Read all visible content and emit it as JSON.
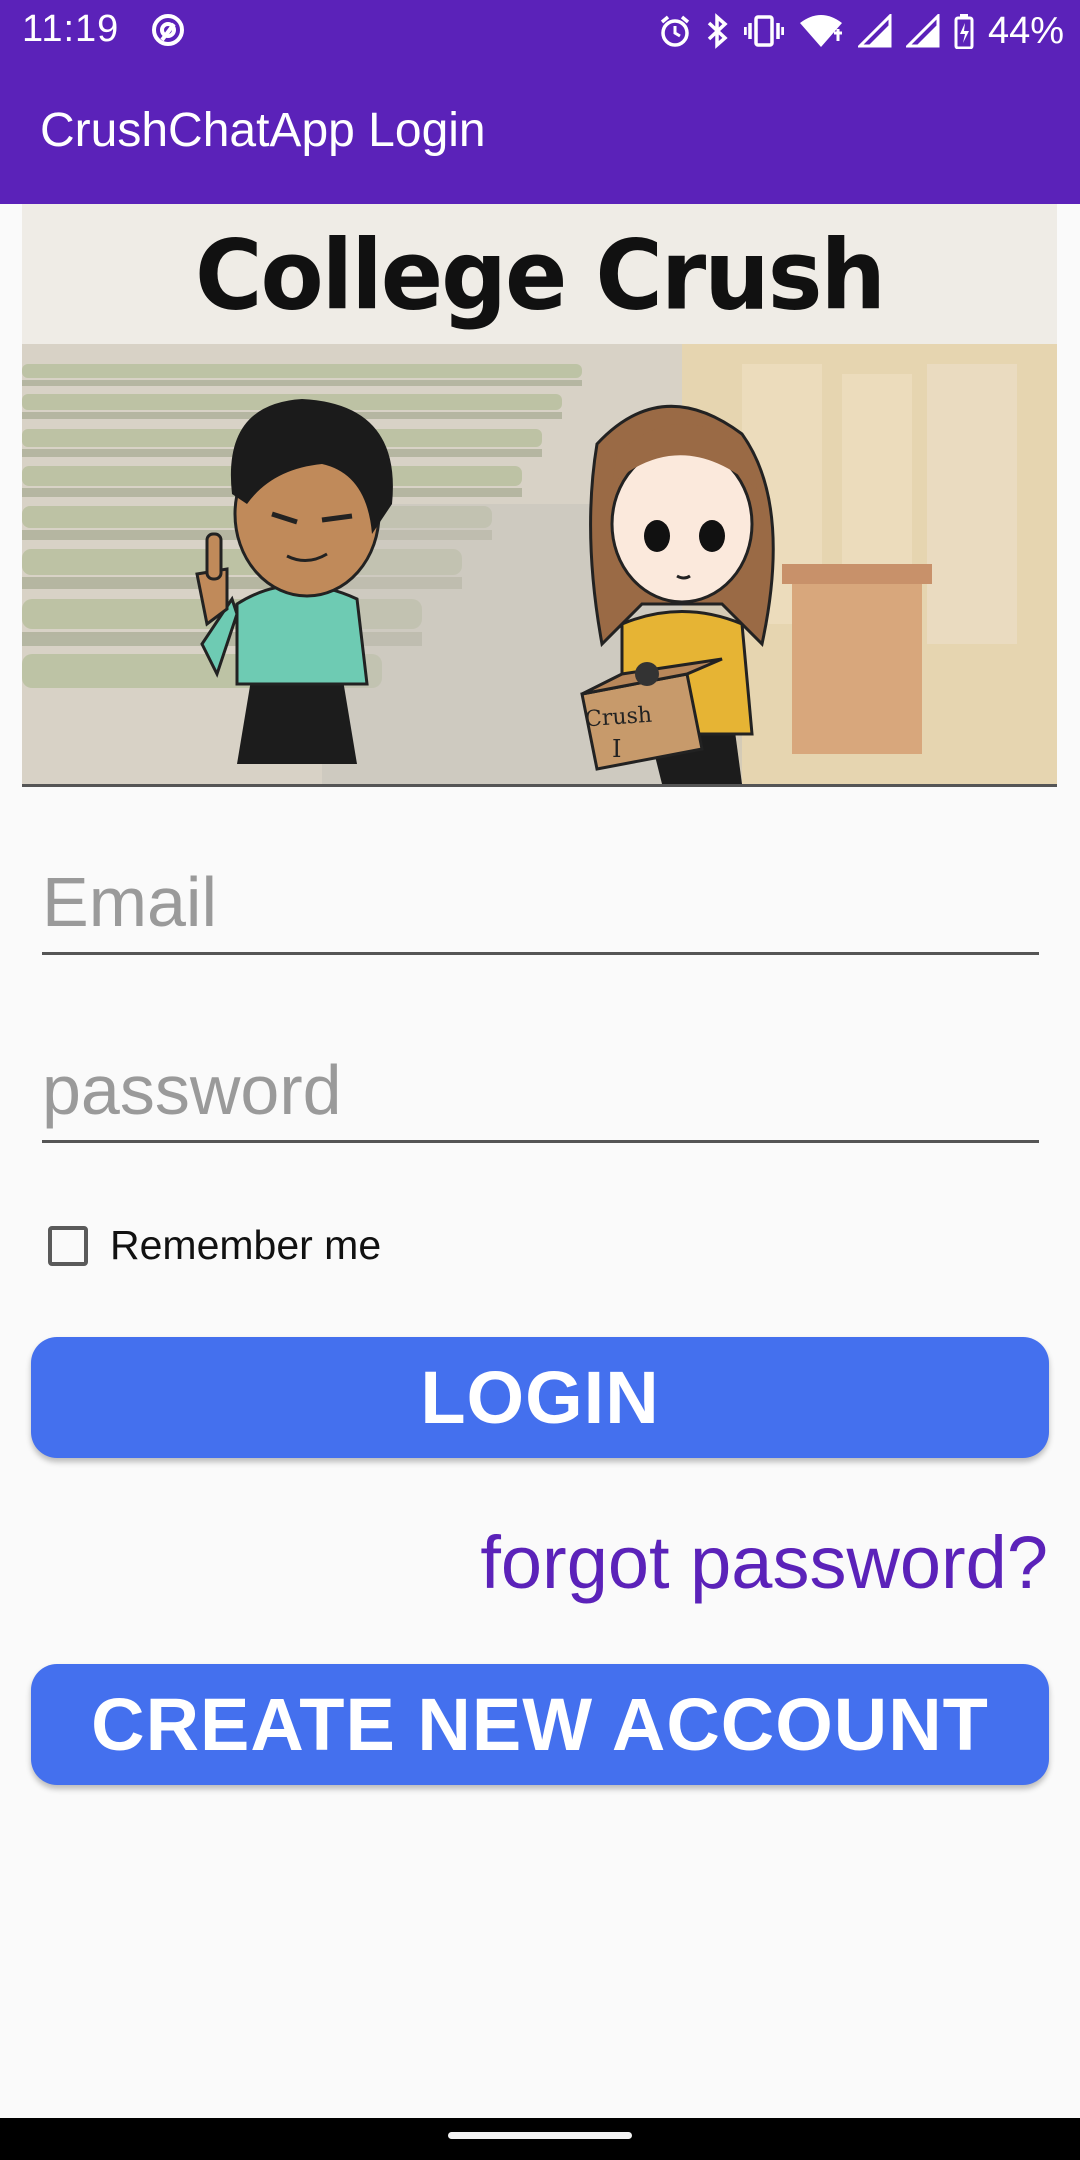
{
  "status_bar": {
    "time": "11:19",
    "battery": "44%",
    "icons": [
      "at-icon",
      "alarm-icon",
      "bluetooth-icon",
      "vibrate-icon",
      "wifi-icon",
      "signal-icon",
      "signal-icon",
      "battery-icon"
    ]
  },
  "app_bar": {
    "title": "CrushChatApp Login",
    "color": "#5b22b9"
  },
  "banner": {
    "title": "College Crush",
    "box_label_1": "Crush",
    "box_label_2": "I"
  },
  "form": {
    "email_placeholder": "Email",
    "password_placeholder": "password",
    "remember_label": "Remember me",
    "remember_checked": false
  },
  "buttons": {
    "login_label": "LOGIN",
    "forgot_label": "forgot password?",
    "create_label": "CREATE NEW ACCOUNT",
    "accent": "#4470ee"
  }
}
